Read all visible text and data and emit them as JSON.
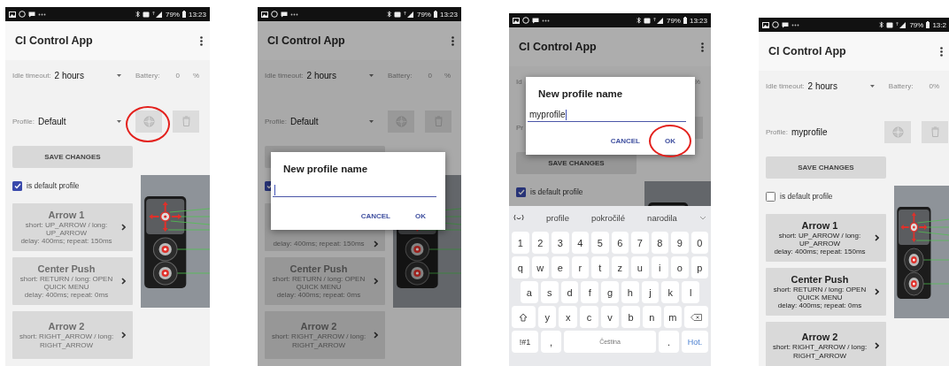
{
  "screens": [
    {
      "status_bar": {
        "battery": "79%",
        "time": "13:23"
      },
      "app_title": "CI Control App",
      "idle": {
        "label": "Idle timeout:",
        "value": "2 hours",
        "battery_label": "Battery:",
        "battery_value": "0",
        "battery_unit": "%"
      },
      "profile": {
        "label": "Profile:",
        "value": "Default",
        "add_circled": true
      },
      "save_button": "SAVE CHANGES",
      "default_checkbox": {
        "label": "is default profile",
        "checked": true
      },
      "cards": [
        {
          "title": "Arrow 1",
          "lines": [
            "short: UP_ARROW / long: UP_ARROW",
            "delay: 400ms; repeat: 150ms"
          ],
          "disabled": true
        },
        {
          "title": "Center Push",
          "lines": [
            "short: RETURN / long: OPEN QUICK MENU",
            "delay: 400ms; repeat: 0ms"
          ],
          "disabled": true
        },
        {
          "title": "Arrow 2",
          "lines": [
            "short: RIGHT_ARROW / long: RIGHT_ARROW"
          ],
          "disabled": true
        }
      ]
    },
    {
      "status_bar": {
        "battery": "79%",
        "time": "13:23"
      },
      "app_title": "CI Control App",
      "dimmed": true,
      "idle": {
        "label": "Idle timeout:",
        "value": "2 hours",
        "battery_label": "Battery:",
        "battery_value": "0",
        "battery_unit": "%"
      },
      "profile": {
        "label": "Profile:",
        "value": "Default"
      },
      "default_checkbox": {
        "checked": true
      },
      "cards": [
        {
          "lines": [
            "delay: 400ms; repeat: 150ms"
          ],
          "disabled": true
        },
        {
          "title": "Center Push",
          "lines": [
            "short: RETURN / long: OPEN QUICK MENU",
            "delay: 400ms; repeat: 0ms"
          ],
          "disabled": true
        },
        {
          "title": "Arrow 2",
          "lines": [
            "short: RIGHT_ARROW / long: RIGHT_ARROW"
          ],
          "disabled": true
        }
      ],
      "dialog": {
        "title": "New profile name",
        "cancel": "CANCEL",
        "ok": "OK"
      }
    },
    {
      "status_bar": {
        "battery": "79%",
        "time": "13:23"
      },
      "app_title": "CI Control App",
      "dimmed": true,
      "idle": {
        "label": "Id",
        "battery_unit": "%"
      },
      "profile": {
        "label": "Pr"
      },
      "save_button": "SAVE CHANGES",
      "default_checkbox": {
        "label": "is default profile",
        "checked": true
      },
      "dialog": {
        "title": "New profile name",
        "value": "myprofile",
        "cancel": "CANCEL",
        "ok": "OK",
        "ok_circled": true
      },
      "keyboard": {
        "suggestions": [
          "profile",
          "pokročilé",
          "narodila"
        ],
        "rows": [
          {
            "keys": [
              "1",
              "2",
              "3",
              "4",
              "5",
              "6",
              "7",
              "8",
              "9",
              "0"
            ]
          },
          {
            "keys": [
              "q",
              "w",
              "e",
              "r",
              "t",
              "z",
              "u",
              "i",
              "o",
              "p"
            ]
          },
          {
            "keys": [
              "a",
              "s",
              "d",
              "f",
              "g",
              "h",
              "j",
              "k",
              "l"
            ]
          },
          {
            "shift": true,
            "keys": [
              "y",
              "x",
              "c",
              "v",
              "b",
              "n",
              "m"
            ],
            "backspace": true
          }
        ],
        "bottom_row": [
          {
            "kind": "symbols",
            "label": "!#1"
          },
          {
            "kind": "key",
            "label": ","
          },
          {
            "kind": "space",
            "label": "Čeština"
          },
          {
            "kind": "key",
            "label": "."
          },
          {
            "kind": "action",
            "label": "Hot."
          }
        ]
      }
    },
    {
      "status_bar": {
        "battery": "79%",
        "time": "13:2"
      },
      "app_title": "CI Control App",
      "idle": {
        "label": "Idle timeout:",
        "value": "2 hours",
        "battery_label": "Battery:",
        "battery_value": "0",
        "battery_unit": "%"
      },
      "profile": {
        "label": "Profile:",
        "value": "myprofile"
      },
      "save_button": "SAVE CHANGES",
      "default_checkbox": {
        "label": "is default profile",
        "checked": false
      },
      "cards": [
        {
          "title": "Arrow 1",
          "lines": [
            "short: UP_ARROW / long: UP_ARROW",
            "delay: 400ms; repeat: 150ms"
          ],
          "disabled": false
        },
        {
          "title": "Center Push",
          "lines": [
            "short: RETURN / long: OPEN QUICK MENU",
            "delay: 400ms; repeat: 0ms"
          ],
          "disabled": false
        },
        {
          "title": "Arrow 2",
          "lines": [
            "short: RIGHT_ARROW / long: RIGHT_ARROW"
          ],
          "disabled": false
        }
      ]
    }
  ]
}
